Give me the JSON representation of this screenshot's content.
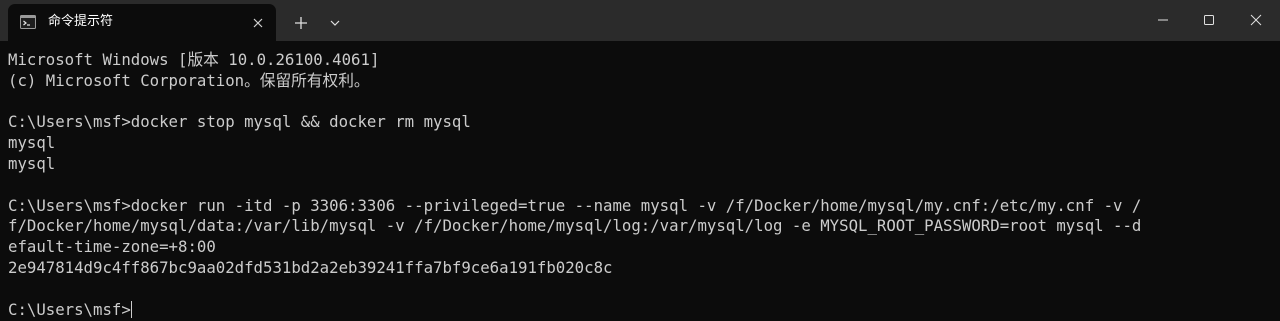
{
  "tab": {
    "icon": "command-prompt-icon",
    "title": "命令提示符"
  },
  "tab_controls": {
    "close_icon": "close-icon",
    "new_tab_icon": "plus-icon",
    "dropdown_icon": "chevron-down-icon"
  },
  "window_controls": {
    "minimize_icon": "minimize-icon",
    "maximize_icon": "maximize-icon",
    "close_icon": "close-icon"
  },
  "terminal": {
    "lines": [
      "Microsoft Windows [版本 10.0.26100.4061]",
      "(c) Microsoft Corporation。保留所有权利。",
      "",
      "C:\\Users\\msf>docker stop mysql && docker rm mysql",
      "mysql",
      "mysql",
      "",
      "C:\\Users\\msf>docker run -itd -p 3306:3306 --privileged=true --name mysql -v /f/Docker/home/mysql/my.cnf:/etc/my.cnf -v /",
      "f/Docker/home/mysql/data:/var/lib/mysql -v /f/Docker/home/mysql/log:/var/mysql/log -e MYSQL_ROOT_PASSWORD=root mysql --d",
      "efault-time-zone=+8:00",
      "2e947814d9c4ff867bc9aa02dfd531bd2a2eb39241ffa7bf9ce6a191fb020c8c",
      ""
    ],
    "prompt": "C:\\Users\\msf>"
  },
  "colors": {
    "background": "#0c0c0c",
    "titlebar": "#2b2b2b",
    "foreground": "#cccccc"
  }
}
